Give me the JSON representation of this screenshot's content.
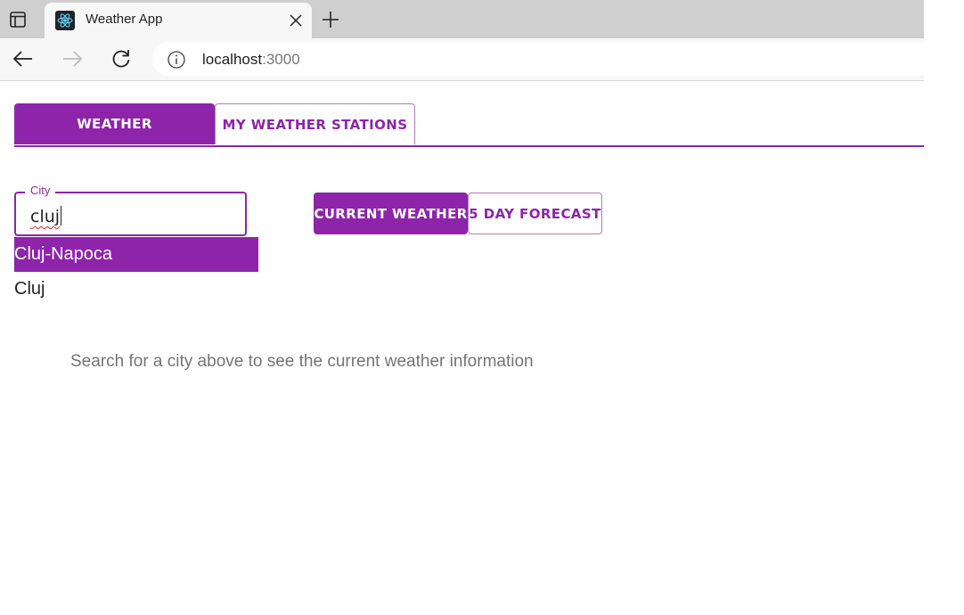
{
  "browser": {
    "tab_title": "Weather App",
    "url_host": "localhost",
    "url_port": ":3000"
  },
  "app": {
    "tabs": [
      {
        "label": "WEATHER",
        "active": true
      },
      {
        "label": "MY WEATHER STATIONS",
        "active": false
      }
    ],
    "city_field": {
      "label": "City",
      "value": "cluj"
    },
    "suggestions": [
      "Cluj-Napoca",
      "Cluj"
    ],
    "view_toggle": [
      {
        "label": "CURRENT WEATHER",
        "active": true
      },
      {
        "label": "5 DAY FORECAST",
        "active": false
      }
    ],
    "hint": "Search for a city above to see the current weather information"
  },
  "colors": {
    "accent": "#8e24aa",
    "tabstrip": "#cfcfcf",
    "toolbar": "#f7f7f7"
  },
  "icons": [
    "tab-actions-icon",
    "react-favicon-icon",
    "close-icon",
    "plus-icon",
    "back-arrow-icon",
    "forward-arrow-icon",
    "reload-icon",
    "info-icon"
  ]
}
